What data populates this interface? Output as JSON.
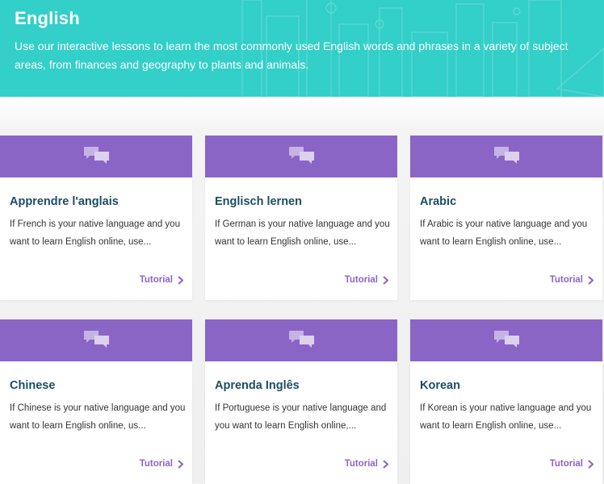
{
  "hero": {
    "title": "English",
    "description": "Use our interactive lessons to learn the most commonly used English words and phrases in a variety of subject areas, from finances and geography to plants and animals."
  },
  "colors": {
    "hero_bg": "#33cfc9",
    "card_header": "#8b65c6",
    "card_title": "#1c4d63",
    "link": "#8b65c6"
  },
  "icons": {
    "card_header": "chat-bubbles-icon",
    "link": "chevron-right-icon"
  },
  "cards": [
    {
      "title": "Apprendre l'anglais",
      "description": "If French is your native language and you want to learn English online, use...",
      "link": "Tutorial"
    },
    {
      "title": "Englisch lernen",
      "description": "If German is your native language and you want to learn English online, use...",
      "link": "Tutorial"
    },
    {
      "title": "Arabic",
      "description": "If Arabic is your native language and you want to learn English online, use...",
      "link": "Tutorial"
    },
    {
      "title": "Chinese",
      "description": "If Chinese is your native language and you want to learn English online, us...",
      "link": "Tutorial"
    },
    {
      "title": "Aprenda Inglês",
      "description": "If Portuguese is your native language and you want to learn English online,...",
      "link": "Tutorial"
    },
    {
      "title": "Korean",
      "description": "If Korean is your native language and you want to learn English online, use...",
      "link": "Tutorial"
    }
  ]
}
